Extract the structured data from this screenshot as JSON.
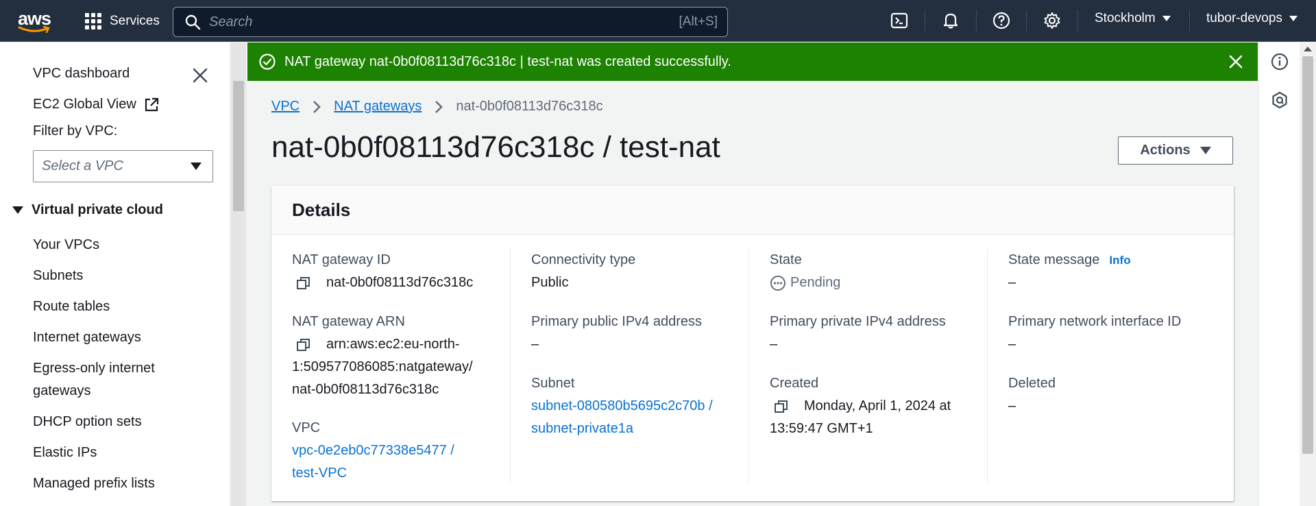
{
  "topnav": {
    "logo_text": "aws",
    "services_label": "Services",
    "search_placeholder": "Search",
    "search_shortcut": "[Alt+S]",
    "region": "Stockholm",
    "account": "tubor-devops",
    "icons": [
      "cloudshell-icon",
      "bell-icon",
      "help-icon",
      "gear-icon"
    ]
  },
  "sidebar": {
    "top_items": [
      "VPC dashboard",
      "EC2 Global View"
    ],
    "filter_label": "Filter by VPC:",
    "filter_placeholder": "Select a VPC",
    "section_title": "Virtual private cloud",
    "items": [
      "Your VPCs",
      "Subnets",
      "Route tables",
      "Internet gateways",
      "Egress-only internet gateways",
      "DHCP option sets",
      "Elastic IPs",
      "Managed prefix lists"
    ]
  },
  "flash": {
    "message": "NAT gateway nat-0b0f08113d76c318c | test-nat was created successfully.",
    "color": "#1d8102"
  },
  "breadcrumb": {
    "items": [
      "VPC",
      "NAT gateways"
    ],
    "current": "nat-0b0f08113d76c318c"
  },
  "page": {
    "title": "nat-0b0f08113d76c318c / test-nat",
    "actions_label": "Actions"
  },
  "details": {
    "heading": "Details",
    "nat_gateway_id_label": "NAT gateway ID",
    "nat_gateway_id": "nat-0b0f08113d76c318c",
    "nat_gateway_arn_label": "NAT gateway ARN",
    "nat_gateway_arn_line1": "arn:aws:ec2:eu-north-",
    "nat_gateway_arn_line2": "1:509577086085:natgateway/",
    "nat_gateway_arn_line3": "nat-0b0f08113d76c318c",
    "vpc_label": "VPC",
    "vpc_line1": "vpc-0e2eb0c77338e5477 /",
    "vpc_line2": "test-VPC",
    "connectivity_type_label": "Connectivity type",
    "connectivity_type": "Public",
    "primary_public_ipv4_label": "Primary public IPv4 address",
    "primary_public_ipv4": "–",
    "subnet_label": "Subnet",
    "subnet_line1": "subnet-080580b5695c2c70b /",
    "subnet_line2": "subnet-private1a",
    "state_label": "State",
    "state": "Pending",
    "primary_private_ipv4_label": "Primary private IPv4 address",
    "primary_private_ipv4": "–",
    "created_label": "Created",
    "created_line1": "Monday, April 1, 2024 at",
    "created_line2": "13:59:47 GMT+1",
    "state_message_label": "State message",
    "info_link": "Info",
    "state_message": "–",
    "primary_eni_label": "Primary network interface ID",
    "primary_eni": "–",
    "deleted_label": "Deleted",
    "deleted": "–"
  },
  "colors": {
    "nav_bg": "#232f3e",
    "link": "#0972d3",
    "success": "#1d8102"
  }
}
